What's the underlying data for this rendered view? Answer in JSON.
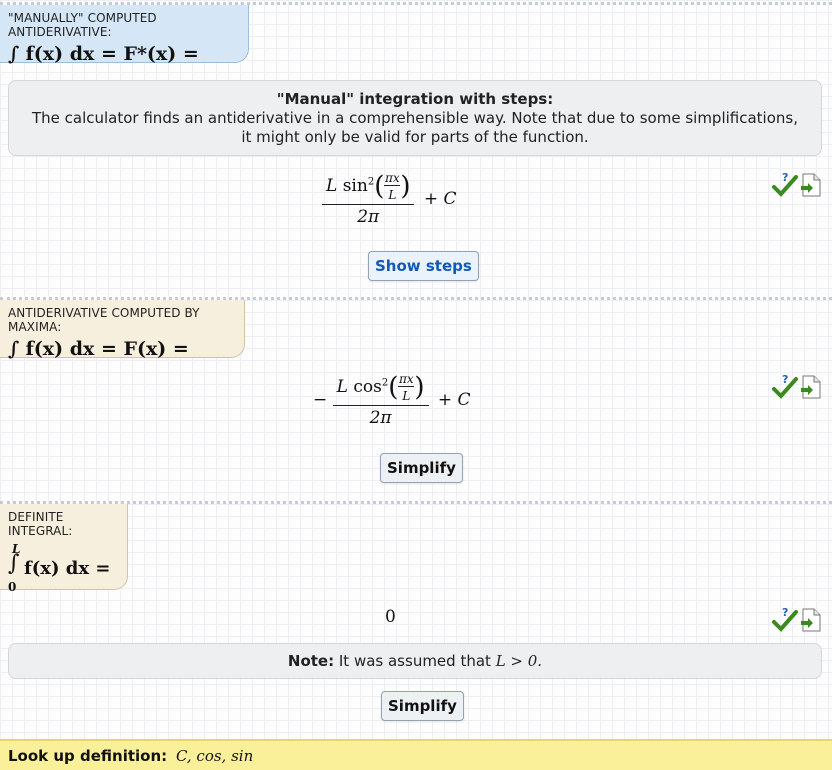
{
  "sections": {
    "manual": {
      "label": "\"MANUALLY\" COMPUTED ANTIDERIVATIVE:",
      "formula": "∫ f(x) dx = F*(x) =",
      "info_title": "\"Manual\" integration with steps:",
      "info_text": "The calculator finds an antiderivative in a comprehensible way. Note that due to some simplifications, it might only be valid for parts of the function.",
      "result": {
        "coef": "L",
        "fn": "sin",
        "power": "2",
        "inner_num": "πx",
        "inner_den": "L",
        "den": "2π",
        "tail": "+ C"
      },
      "button": "Show steps"
    },
    "maxima": {
      "label": "ANTIDERIVATIVE COMPUTED BY MAXIMA:",
      "formula": "∫ f(x) dx = F(x) =",
      "result": {
        "sign": "−",
        "coef": "L",
        "fn": "cos",
        "power": "2",
        "inner_num": "πx",
        "inner_den": "L",
        "den": "2π",
        "tail": "+ C"
      },
      "button": "Simplify"
    },
    "definite": {
      "label": "DEFINITE INTEGRAL:",
      "upper": "L",
      "lower": "0",
      "formula": "f(x) dx =",
      "result": "0",
      "note_label": "Note:",
      "note_text": "It was assumed that",
      "note_math": "L > 0.",
      "button": "Simplify"
    }
  },
  "footer": {
    "label": "Look up definition:",
    "terms": "C, cos, sin"
  },
  "icons": [
    "check-question-icon",
    "export-document-icon"
  ],
  "colors": {
    "label_blue": "#d5e7f7",
    "label_beige": "#f7efde",
    "footer_yellow": "#fbf09a",
    "check_green": "#3a8a1f",
    "button_text_blue": "#1359b8"
  }
}
